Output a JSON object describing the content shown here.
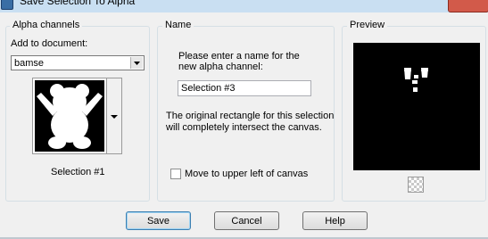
{
  "window": {
    "title": "Save Selection To Alpha"
  },
  "alpha_channels": {
    "legend": "Alpha channels",
    "add_to_label": "Add to document:",
    "document_value": "bamse",
    "selection_label": "Selection #1"
  },
  "name_group": {
    "legend": "Name",
    "instruction_line1": "Please enter a name for the",
    "instruction_line2": "new alpha channel:",
    "name_value": "Selection #3",
    "info_line1": "The original rectangle for this selection",
    "info_line2": "will completely intersect the canvas.",
    "move_checkbox_label": "Move to upper left of canvas",
    "move_checked": false
  },
  "preview": {
    "legend": "Preview"
  },
  "buttons": {
    "save": "Save",
    "cancel": "Cancel",
    "help": "Help"
  }
}
